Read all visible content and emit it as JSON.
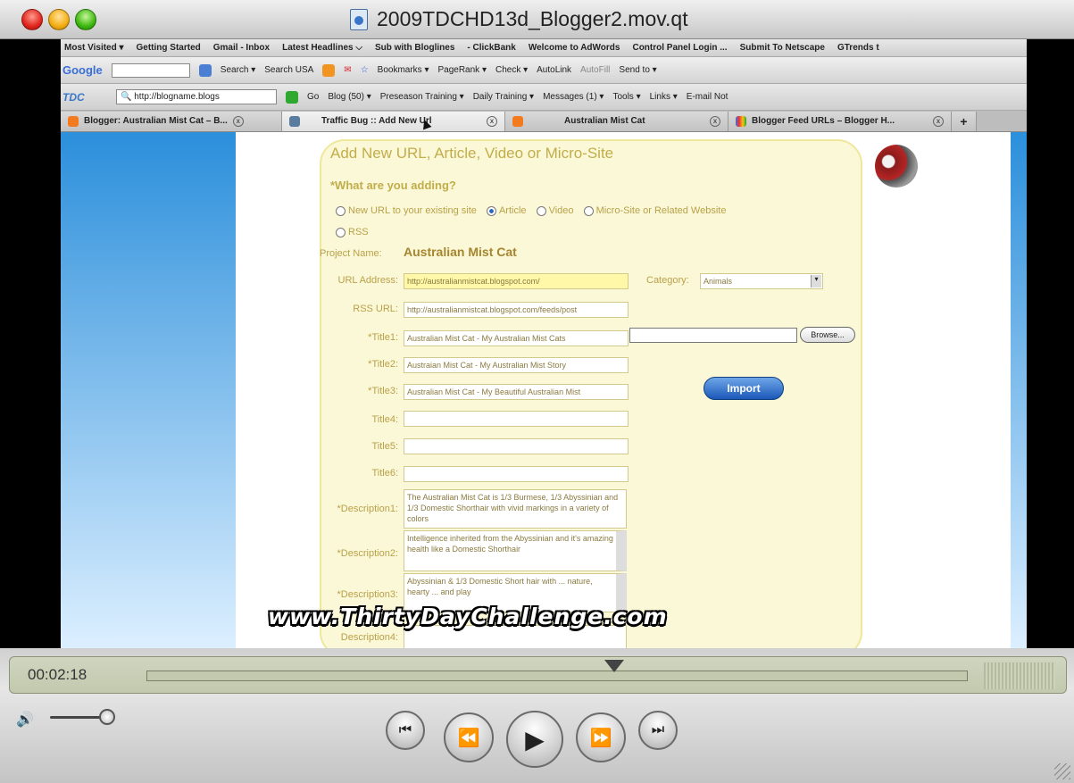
{
  "window": {
    "title": "2009TDCHD13d_Blogger2.mov.qt"
  },
  "bookmarks": [
    "Most Visited ▾",
    "Getting Started",
    "Gmail - Inbox",
    "Latest Headlines ⌵",
    "Sub with Bloglines",
    "- ClickBank",
    "Welcome to AdWords",
    "Control Panel Login ...",
    "Submit To Netscape",
    "GTrends t"
  ],
  "google_toolbar": {
    "logo": "Google",
    "items": [
      "Search ▾",
      "Search USA",
      "Bookmarks ▾",
      "PageRank ▾",
      "Check ▾",
      "AutoLink",
      "AutoFill",
      "Send to ▾"
    ]
  },
  "tdc_toolbar": {
    "logo": "TDC",
    "url": "http://blogname.blogs",
    "go": "Go",
    "items": [
      "Blog (50) ▾",
      "Preseason Training ▾",
      "Daily Training ▾",
      "Messages (1) ▾",
      "Tools ▾",
      "Links ▾",
      "E-mail Not"
    ]
  },
  "tabs": [
    {
      "label": "Blogger: Australian Mist Cat – B..."
    },
    {
      "label": "Traffic Bug :: Add New Url"
    },
    {
      "label": "Australian Mist Cat"
    },
    {
      "label": "Blogger Feed URLs – Blogger H..."
    }
  ],
  "form": {
    "heading": "Add New URL, Article, Video or Micro-Site",
    "question": "*What are you adding?",
    "options": [
      "New URL to your existing site",
      "Article",
      "Video",
      "Micro-Site or Related Website",
      "RSS"
    ],
    "selected_option": "Article",
    "project_label": "Project Name:",
    "project_name": "Australian Mist Cat",
    "url_label": "URL Address:",
    "url_value": "http://australianmistcat.blogspot.com/",
    "category_label": "Category:",
    "category_value": "Animals",
    "rss_label": "RSS URL:",
    "rss_value": "http://australianmistcat.blogspot.com/feeds/post",
    "browse": "Browse...",
    "import": "Import",
    "titles": [
      {
        "label": "*Title1:",
        "value": "Australian Mist Cat - My Australian Mist Cats"
      },
      {
        "label": "*Title2:",
        "value": "Austraian Mist Cat - My Australian Mist Story"
      },
      {
        "label": "*Title3:",
        "value": "Australian Mist Cat - My Beautiful Australian Mist"
      },
      {
        "label": "Title4:",
        "value": ""
      },
      {
        "label": "Title5:",
        "value": ""
      },
      {
        "label": "Title6:",
        "value": ""
      }
    ],
    "descriptions": [
      {
        "label": "*Description1:",
        "value": "The Australian Mist Cat is 1/3 Burmese, 1/3 Abyssinian and 1/3 Domestic Shorthair with vivid markings in a variety of colors"
      },
      {
        "label": "*Description2:",
        "value": "Intelligence inherited from the Abyssinian and it's amazing health like a Domestic Shorthair"
      },
      {
        "label": "*Description3:",
        "value": "Abyssinian & 1/3 Domestic Short hair with ... nature, hearty ... and play"
      },
      {
        "label": "Description4:",
        "value": ""
      }
    ]
  },
  "watermark": "www.ThirtyDayChallenge.com",
  "player": {
    "time": "00:02:18",
    "progress": 0.57,
    "volume": 0.9
  }
}
